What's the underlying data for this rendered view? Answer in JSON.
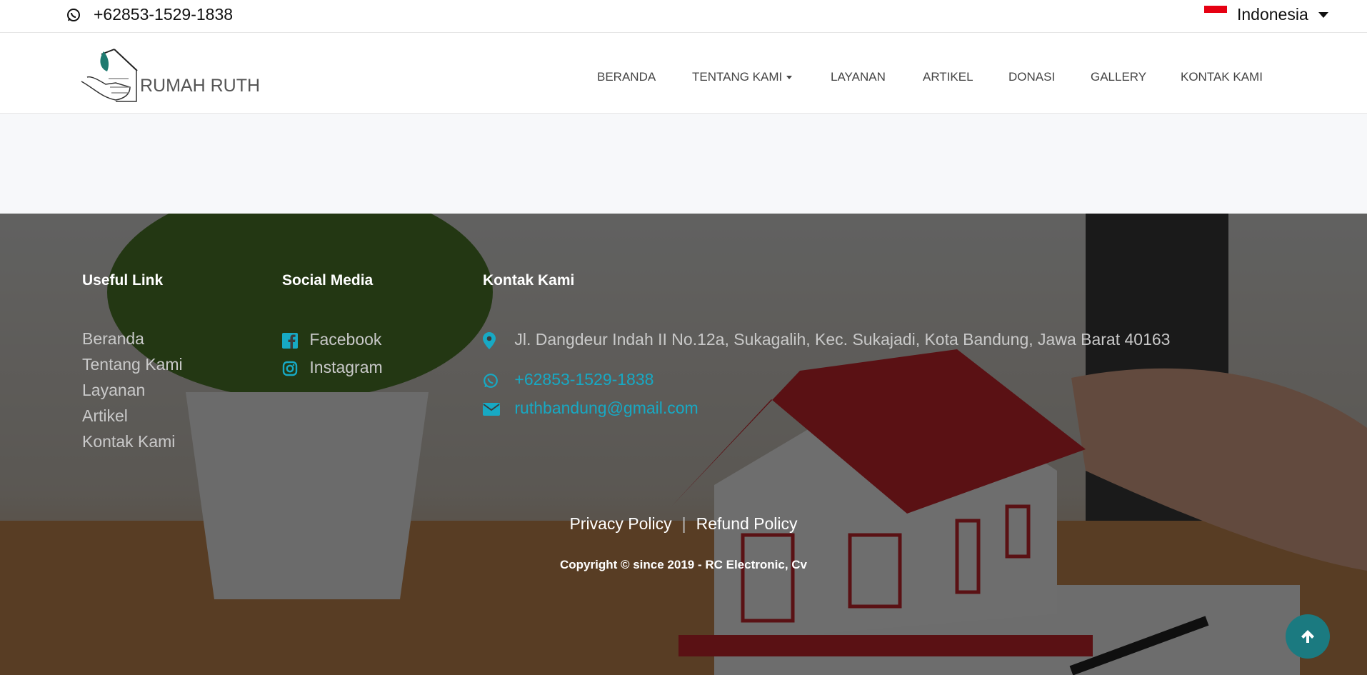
{
  "topbar": {
    "phone": "+62853-1529-1838",
    "language": "Indonesia"
  },
  "logo_text": "RUMAH RUTH",
  "nav": [
    {
      "label": "BERANDA"
    },
    {
      "label": "TENTANG KAMI"
    },
    {
      "label": "LAYANAN"
    },
    {
      "label": "ARTIKEL"
    },
    {
      "label": "DONASI"
    },
    {
      "label": "GALLERY"
    },
    {
      "label": "KONTAK KAMI"
    }
  ],
  "footer": {
    "useful": {
      "title": "Useful Link",
      "items": [
        "Beranda",
        "Tentang Kami",
        "Layanan",
        "Artikel",
        "Kontak Kami"
      ]
    },
    "social": {
      "title": "Social Media",
      "items": [
        "Facebook",
        "Instagram"
      ]
    },
    "contact": {
      "title": "Kontak Kami",
      "address": "Jl. Dangdeur Indah II No.12a, Sukagalih, Kec. Sukajadi, Kota Bandung, Jawa Barat 40163",
      "phone": "+62853-1529-1838",
      "email": "ruthbandung@gmail.com"
    },
    "privacy": "Privacy Policy",
    "separator": "|",
    "refund": "Refund Policy",
    "copyright": "Copyright © since 2019 - RC Electronic, Cv"
  },
  "colors": {
    "accent": "#17a9c4",
    "scroll_top": "#1b7a80",
    "flag_red": "#e60012"
  }
}
